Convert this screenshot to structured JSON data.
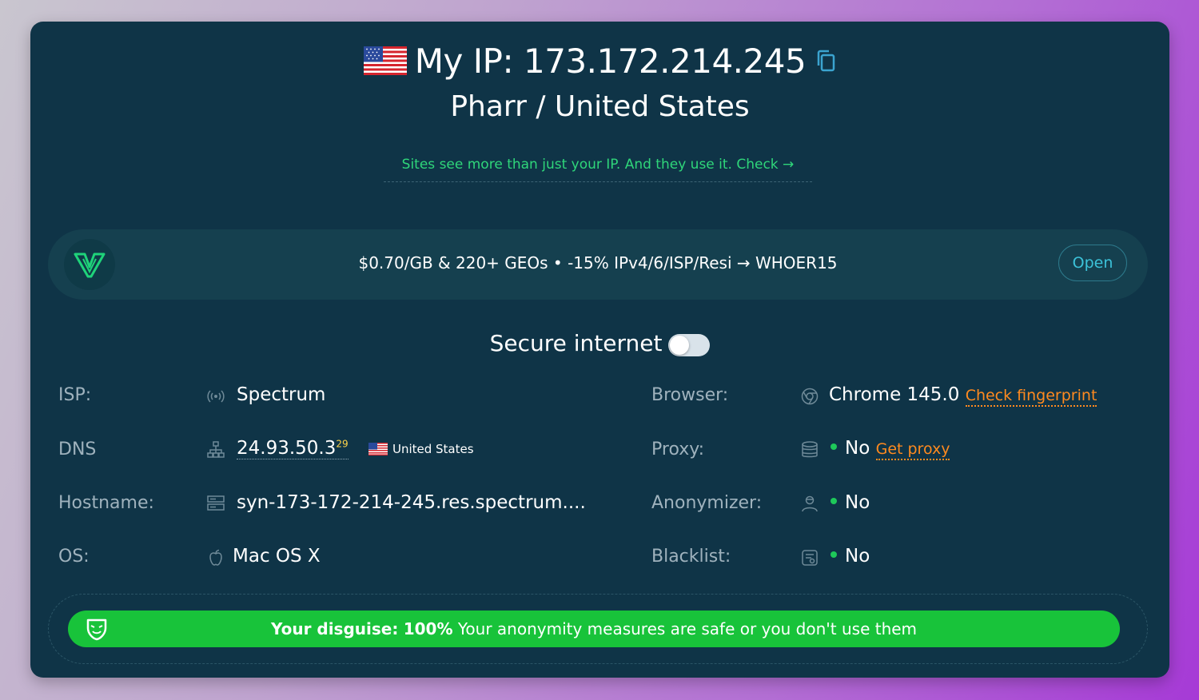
{
  "header": {
    "ip_prefix": "My IP: ",
    "ip": "173.172.214.245",
    "location": "Pharr / United States",
    "check_link": "Sites see more than just your IP. And they use it. Check →"
  },
  "promo": {
    "text": "$0.70/GB & 220+ GEOs • -15% IPv4/6/ISP/Resi → WHOER15",
    "button": "Open"
  },
  "secure": {
    "label": "Secure internet",
    "enabled": false
  },
  "left_rows": [
    {
      "label": "ISP:",
      "value": "Spectrum",
      "icon": "signal-icon"
    },
    {
      "label": "DNS",
      "value": "24.93.50.3",
      "sup": "29",
      "country": "United States",
      "icon": "network-icon"
    },
    {
      "label": "Hostname:",
      "value": "syn-173-172-214-245.res.spectrum....",
      "icon": "server-icon"
    },
    {
      "label": "OS:",
      "value": "Mac OS X",
      "icon": "apple-icon"
    }
  ],
  "right_rows": [
    {
      "label": "Browser:",
      "value": "Chrome 145.0",
      "link": "Check fingerprint",
      "icon": "browser-icon"
    },
    {
      "label": "Proxy:",
      "value": "No",
      "link": "Get proxy",
      "status": "green",
      "icon": "database-icon"
    },
    {
      "label": "Anonymizer:",
      "value": "No",
      "status": "green",
      "icon": "user-icon"
    },
    {
      "label": "Blacklist:",
      "value": "No",
      "status": "green",
      "icon": "list-icon"
    }
  ],
  "disguise": {
    "label": "Your disguise:",
    "percent": "100%",
    "message": " Your anonymity measures are safe or you don't use them"
  },
  "colors": {
    "card_bg": "#0f3447",
    "accent_green": "#18c33a",
    "link_orange": "#ff8a1f",
    "check_green": "#2fd67a"
  }
}
